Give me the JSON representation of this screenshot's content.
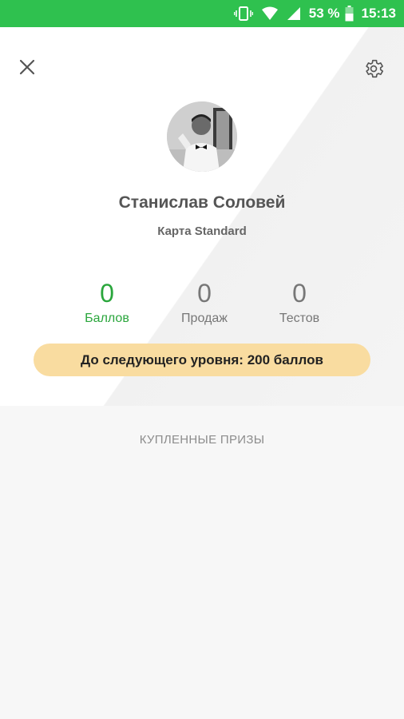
{
  "status_bar": {
    "battery_percent": "53 %",
    "time": "15:13",
    "icons": [
      "vibrate-icon",
      "wifi-icon",
      "signal-icon",
      "battery-icon"
    ]
  },
  "header": {
    "close_icon": "close-icon",
    "settings_icon": "gear-icon"
  },
  "profile": {
    "name": "Станислав Соловей",
    "card": "Карта Standard"
  },
  "stats": [
    {
      "value": "0",
      "label": "Баллов",
      "color": "#2aa63c"
    },
    {
      "value": "0",
      "label": "Продаж",
      "color": "#777777"
    },
    {
      "value": "0",
      "label": "Тестов",
      "color": "#777777"
    }
  ],
  "level_banner": "До следующего уровня: 200 баллов",
  "prizes_section_title": "КУПЛЕННЫЕ ПРИЗЫ",
  "colors": {
    "status_bar": "#2fc14f",
    "accent_green": "#2aa63c",
    "banner": "#f9dca0"
  }
}
